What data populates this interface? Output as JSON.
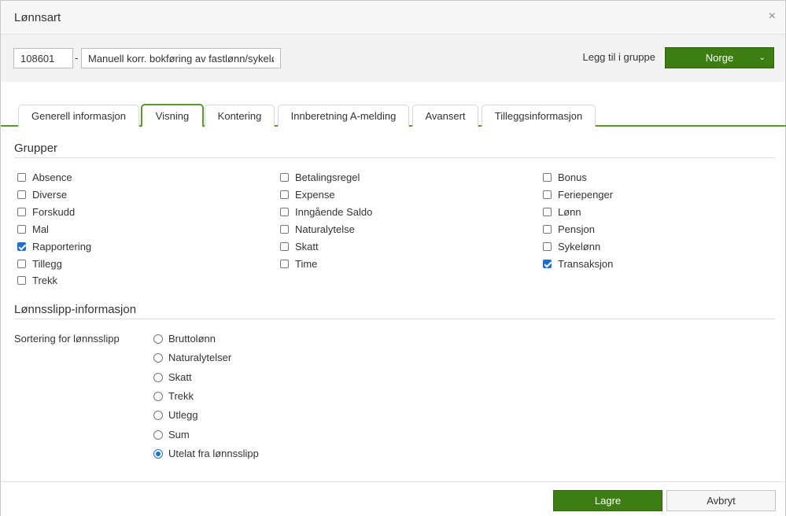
{
  "dialog": {
    "title": "Lønnsart",
    "close_glyph": "×"
  },
  "topbar": {
    "code_value": "108601",
    "separator": "-",
    "name_value": "Manuell korr. bokføring av fastlønn/sykelø",
    "group_label": "Legg til i gruppe",
    "group_button": "Norge"
  },
  "tabs": [
    {
      "label": "Generell informasjon",
      "active": false
    },
    {
      "label": "Visning",
      "active": true
    },
    {
      "label": "Kontering",
      "active": false
    },
    {
      "label": "Innberetning A-melding",
      "active": false
    },
    {
      "label": "Avansert",
      "active": false
    },
    {
      "label": "Tilleggsinformasjon",
      "active": false
    }
  ],
  "groups": {
    "title": "Grupper",
    "col1": [
      {
        "label": "Absence",
        "checked": false
      },
      {
        "label": "Diverse",
        "checked": false
      },
      {
        "label": "Forskudd",
        "checked": false
      },
      {
        "label": "Mal",
        "checked": false
      },
      {
        "label": "Rapportering",
        "checked": true
      },
      {
        "label": "Tillegg",
        "checked": false
      },
      {
        "label": "Trekk",
        "checked": false
      }
    ],
    "col2": [
      {
        "label": "Betalingsregel",
        "checked": false
      },
      {
        "label": "Expense",
        "checked": false
      },
      {
        "label": "Inngående Saldo",
        "checked": false
      },
      {
        "label": "Naturalytelse",
        "checked": false
      },
      {
        "label": "Skatt",
        "checked": false
      },
      {
        "label": "Time",
        "checked": false
      }
    ],
    "col3": [
      {
        "label": "Bonus",
        "checked": false
      },
      {
        "label": "Feriepenger",
        "checked": false
      },
      {
        "label": "Lønn",
        "checked": false
      },
      {
        "label": "Pensjon",
        "checked": false
      },
      {
        "label": "Sykelønn",
        "checked": false
      },
      {
        "label": "Transaksjon",
        "checked": true
      }
    ]
  },
  "payslip": {
    "title": "Lønnsslipp-informasjon",
    "sort_label": "Sortering for lønnsslipp",
    "options": [
      {
        "label": "Bruttolønn",
        "selected": false
      },
      {
        "label": "Naturalytelser",
        "selected": false
      },
      {
        "label": "Skatt",
        "selected": false
      },
      {
        "label": "Trekk",
        "selected": false
      },
      {
        "label": "Utlegg",
        "selected": false
      },
      {
        "label": "Sum",
        "selected": false
      },
      {
        "label": "Utelat fra lønnsslipp",
        "selected": true
      }
    ]
  },
  "footer": {
    "save_label": "Lagre",
    "cancel_label": "Avbryt"
  },
  "colors": {
    "accent": "#3d7d13",
    "tab_border": "#5a9a2c",
    "check": "#1f6fd0"
  }
}
